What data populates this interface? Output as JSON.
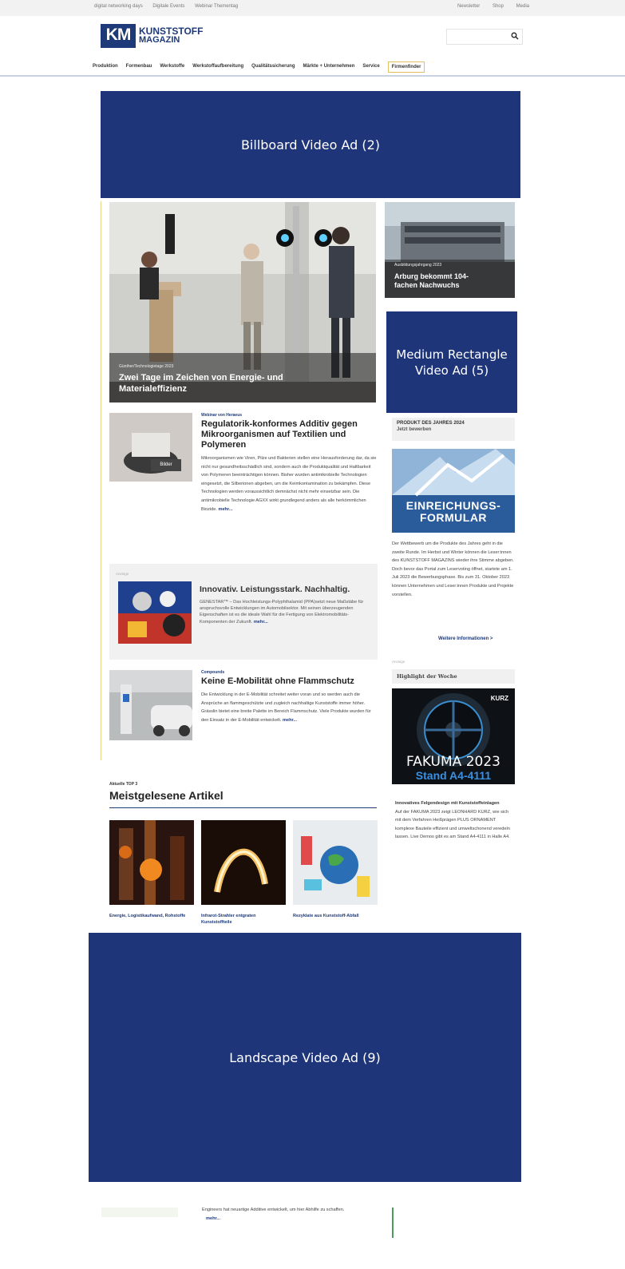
{
  "topbar": {
    "left_links": [
      "digital networking days",
      "Digitale Events",
      "Webinar Thementag"
    ],
    "right_links": [
      "Newsletter",
      "Shop",
      "Media"
    ]
  },
  "logo": {
    "mark": "KM",
    "line1": "KUNSTSTOFF",
    "line2": "MAGAZIN"
  },
  "search": {
    "placeholder": ""
  },
  "nav": {
    "items": [
      "Produktion",
      "Formenbau",
      "Werkstoffe",
      "Werkstoffaufbereitung",
      "Qualitätssicherung",
      "Märkte + Unternehmen",
      "Service"
    ],
    "highlight": "Firmenfinder"
  },
  "ads": {
    "billboard": "Billboard Video Ad (2)",
    "medium_rectangle": "Medium Rectangle Video Ad (5)",
    "landscape": "Landscape Video Ad (9)"
  },
  "hero": {
    "kicker": "Günther/Technologietage 2023",
    "title": "Zwei Tage im Zeichen von Energie- und Materialeffizienz"
  },
  "side_top": {
    "kicker": "Ausbildungsjahrgang 2023",
    "title": "Arburg bekommt 104-fachen Nachwuchs"
  },
  "article1": {
    "kicker": "Webinar von Heraeus",
    "title": "Regulatorik-konformes Additiv gegen Mikroorganismen auf Textilien und Polymeren",
    "button": "Bilder",
    "text": "Mikroorganismen wie Viren, Pilze und Bakterien stellen eine Herausforderung dar, da sie nicht nur gesundheitsschädlich sind, sondern auch die Produktqualität und Haltbarkeit von Polymeren beeinträchtigen können. Bisher wurden antimikrobielle Technologien eingesetzt, die Silberionen abgeben, um die Keimkontamination zu bekämpfen. Diese Technologien werden voraussichtlich demnächst nicht mehr einsetzbar sein. Die antimikrobielle Technologie AGXX wirkt grundlegend anders als alle herkömmlichen Biozide.",
    "more": "mehr..."
  },
  "ad_article": {
    "label": "Anzeige",
    "title": "Innovativ. Leistungsstark. Nachhaltig.",
    "text": "GENESTAR™ – Das Hochleistungs-Polyphthalamid (PPA)setzt neue Maßstäbe für anspruchsvolle Entwicklungen im Automobilsektor. Mit seinen überzeugenden Eigenschaften ist es die ideale Wahl für die Fertigung von Elektromobilitäts-Komponenten der Zukunft.",
    "more": "mehr..."
  },
  "article3": {
    "kicker": "Compounds",
    "title": "Keine E-Mobilität ohne Flammschutz",
    "text": "Die Entwicklung in der E-Mobilität schreitet weiter voran und so werden auch die Ansprüche an flammgeschützte und zugleich nachhaltige Kunststoffe immer höher. Grässlin bietet eine breite Palette im Bereich Flammschutz. Viele Produkte wurden für den Einsatz in der E-Mobilität entwickelt.",
    "more": "mehr..."
  },
  "top3": {
    "label": "Aktuelle TOP 3",
    "title": "Meistgelesene Artikel",
    "items": [
      {
        "caption": "Energie, Logistikaufwand, Rohstoffe"
      },
      {
        "caption": "Infrarot-Strahler entgraten Kunststoffteile"
      },
      {
        "caption": "Rezyklate aus Kunststoff-Abfall"
      }
    ]
  },
  "sidebar": {
    "pdj_title": "PRODUKT DES JAHRES 2024",
    "pdj_sub": "Jetzt bewerben",
    "formular_line1": "EINREICHUNGS-",
    "formular_line2": "FORMULAR",
    "pdj_text": "Der Wettbewerb um die Produkte des Jahres geht in die zweite Runde. Im Herbst und Winter können die Leser:innen des KUNSTSTOFF MAGAZINS wieder ihre Stimme abgeben. Doch bevor das Portal zum Leservoting öffnet, startete am 1. Juli 2023 die Bewerbungsphase. Bis zum 31. Oktober 2023 können Unternehmen und Leser:innen Produkte und Projekte vorstellen.",
    "pdj_more": "Weitere Informationen  >",
    "anzeige": "Anzeige",
    "highlight_title": "Highlight der Woche",
    "kurz_brand": "KURZ",
    "kurz_line1": "FAKUMA 2023",
    "kurz_line2": "Stand A4-4111",
    "kurz_head": "Innovatives Felgendesign mit Kunststoffeinlagen",
    "kurz_text": "Auf der FAKUMA 2023 zeigt LEONHARD KURZ, wie sich mit dem Verfahren Heißprägen PLUS ORNAMENT komplexe Bauteile effizient und umweltschonend veredeln lassen. Live Demos gibt es am Stand A4-4111 in Halle A4."
  },
  "bottom": {
    "text": "Engineers hat neuartige Additive entwickelt, um hier Abhilfe zu schaffen.",
    "more": "mehr..."
  },
  "colors": {
    "brand_blue": "#1e3a78",
    "ad_blue": "#1f357a"
  }
}
